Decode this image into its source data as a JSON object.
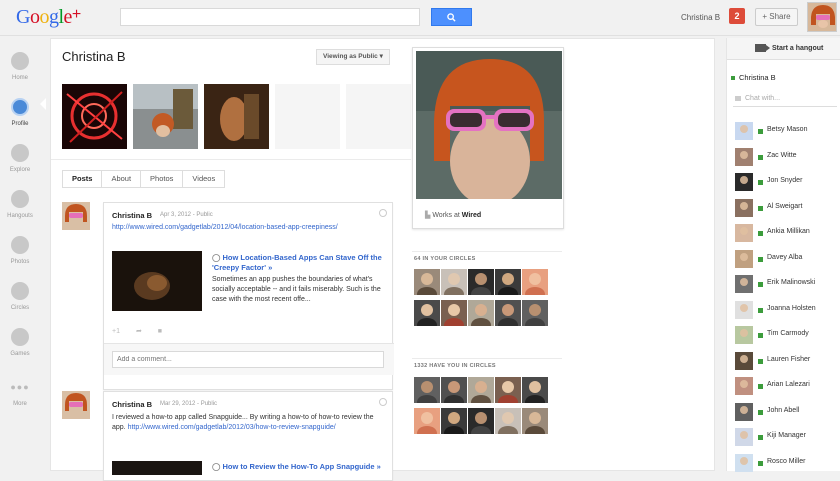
{
  "app": {
    "logo_text": "Google",
    "logo_plus": "+",
    "search_placeholder": "",
    "user_name": "Christina B",
    "notification_count": "2",
    "share_label": "+ Share"
  },
  "nav": {
    "items": [
      {
        "label": "Home"
      },
      {
        "label": "Profile"
      },
      {
        "label": "Explore"
      },
      {
        "label": "Hangouts"
      },
      {
        "label": "Photos"
      },
      {
        "label": "Circles"
      },
      {
        "label": "Games"
      },
      {
        "label": "More"
      }
    ]
  },
  "profile": {
    "name": "Christina B",
    "viewing_as": "Viewing as Public",
    "tabs": [
      "Posts",
      "About",
      "Photos",
      "Videos"
    ],
    "works_at_prefix": "Works at",
    "works_at": "Wired"
  },
  "posts": [
    {
      "author": "Christina B",
      "date": "Apr 3, 2012",
      "visibility": "Public",
      "link": "http://www.wired.com/gadgetlab/2012/04/location-based-app-creepiness/",
      "share_title": "How Location-Based Apps Can Stave Off the 'Creepy Factor' »",
      "share_desc": "Sometimes an app pushes the boundaries of what's socially acceptable -- and it fails miserably. Such is the case with the most recent offe...",
      "plus_one": "+1",
      "comment_placeholder": "Add a comment..."
    },
    {
      "author": "Christina B",
      "date": "Mar 29, 2012",
      "visibility": "Public",
      "text_before": "I reviewed a how-to app called Snapguide... By writing a how-to of how-to review the app. ",
      "text_link": "http://www.wired.com/gadgetlab/2012/03/how-to-review-snapguide/",
      "share_title": "How to Review the How-To App Snapguide »"
    }
  ],
  "circles": {
    "in_your_circles": "64 IN YOUR CIRCLES",
    "have_you": "1332 HAVE YOU IN CIRCLES"
  },
  "chat": {
    "hangout_label": "Start a hangout",
    "self_name": "Christina B",
    "chat_placeholder": "Chat with...",
    "contacts": [
      "Betsy Mason",
      "Zac Witte",
      "Jon Snyder",
      "Al Sweigart",
      "Ankia Millikan",
      "Davey Alba",
      "Erik Malinowski",
      "Joanna Holsten",
      "Tim Carmody",
      "Lauren Fisher",
      "Arian Lalezari",
      "John Abell",
      "Kiji Manager",
      "Rosco Miller"
    ]
  },
  "colors": {
    "accent_blue": "#4d90fe",
    "link_blue": "#3366cc",
    "notification_red": "#dd4b39",
    "online_green": "#3c9c3c"
  }
}
